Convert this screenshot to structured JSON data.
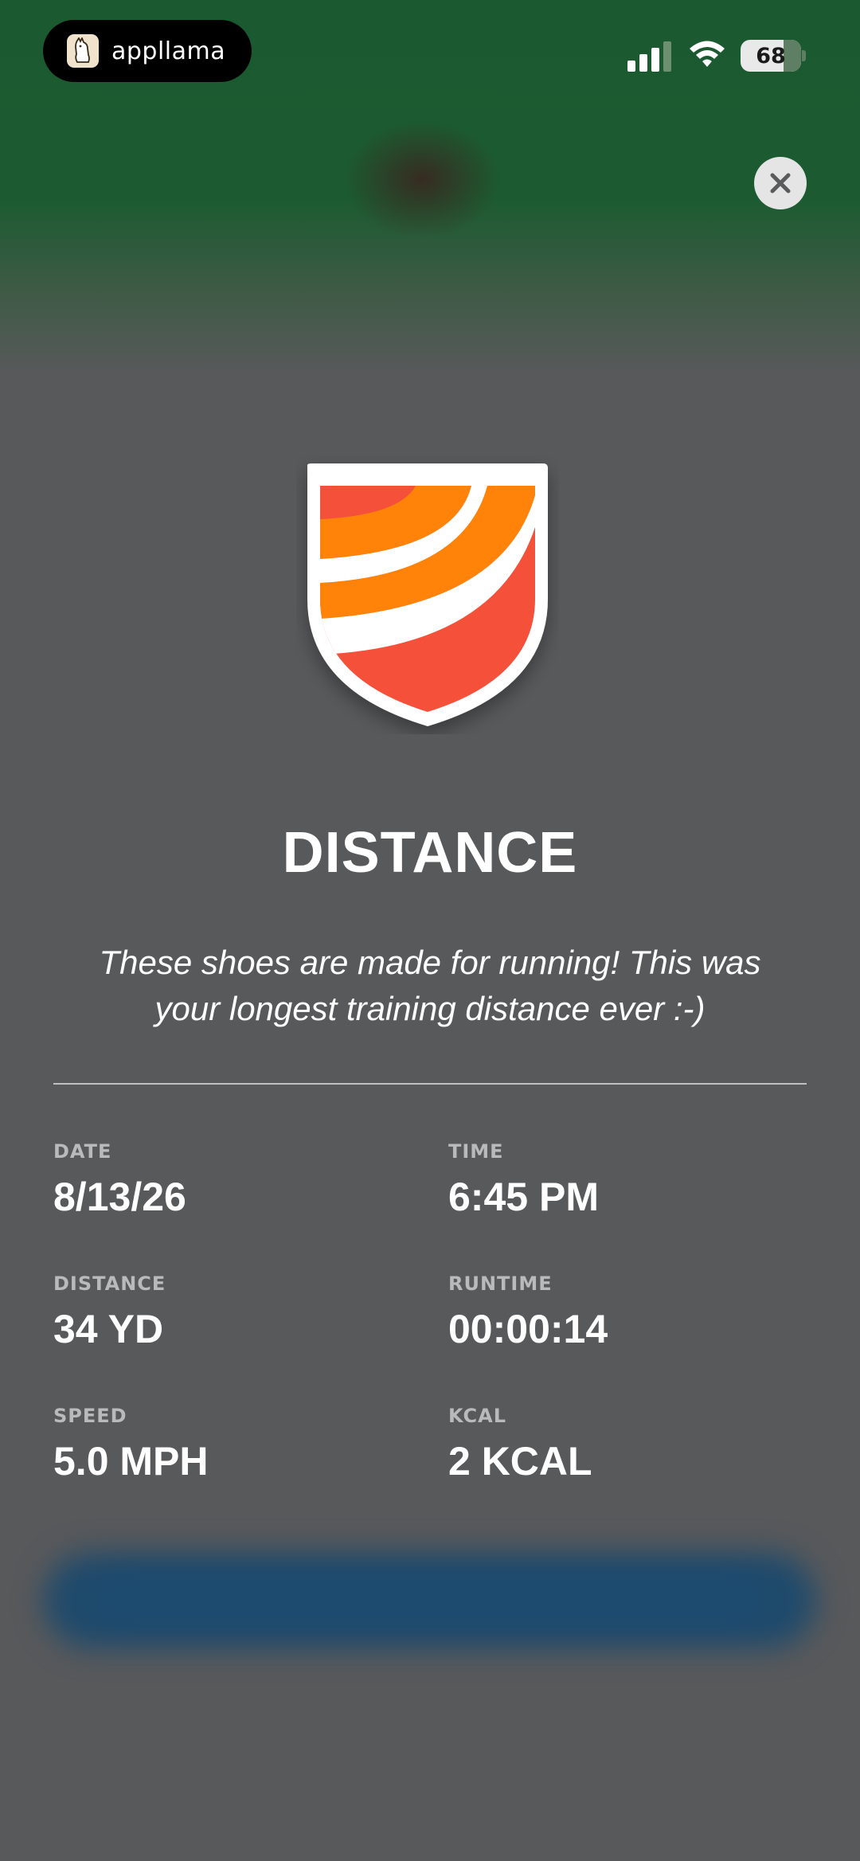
{
  "status_bar": {
    "app_pill_text": "appllama",
    "battery_level": "68",
    "signal_bars": 4,
    "wifi": true
  },
  "icons": {
    "close": "close-icon",
    "badge": "shield-badge-icon"
  },
  "achievement": {
    "title": "DISTANCE",
    "description": "These shoes are made for running! This was your longest training distance ever :-)"
  },
  "stats": [
    {
      "label": "DATE",
      "value": "8/13/26"
    },
    {
      "label": "TIME",
      "value": "6:45 PM"
    },
    {
      "label": "DISTANCE",
      "value": "34 YD"
    },
    {
      "label": "RUNTIME",
      "value": "00:00:14"
    },
    {
      "label": "SPEED",
      "value": "5.0 MPH"
    },
    {
      "label": "KCAL",
      "value": "2 KCAL"
    }
  ],
  "colors": {
    "background": "#58595b",
    "top_green": "#1b5a30",
    "badge_red": "#f5503a",
    "badge_orange": "#ff8209",
    "blurred_button": "#1f4a6c"
  }
}
